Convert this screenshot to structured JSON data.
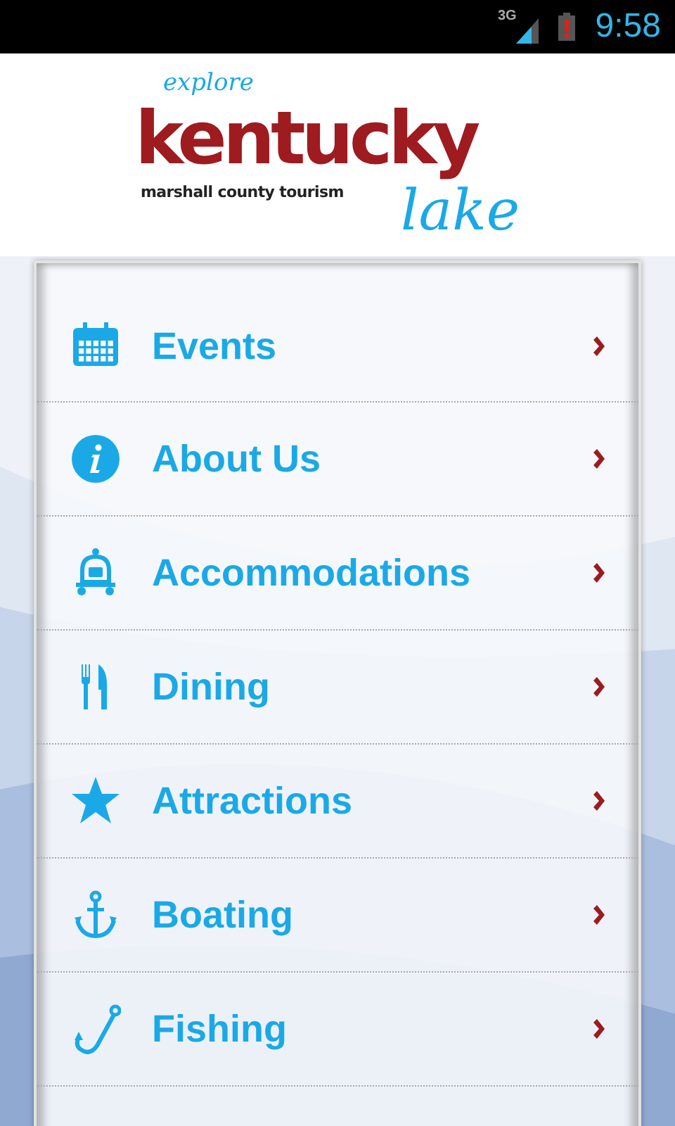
{
  "status_bar": {
    "network": "3G",
    "time": "9:58"
  },
  "logo": {
    "top_word": "explore",
    "main_word": "kentucky",
    "tagline": "marshall county tourism",
    "script_word": "lake"
  },
  "menu": {
    "items": [
      {
        "label": "Events"
      },
      {
        "label": "About Us"
      },
      {
        "label": "Accommodations"
      },
      {
        "label": "Dining"
      },
      {
        "label": "Attractions"
      },
      {
        "label": "Boating"
      },
      {
        "label": "Fishing"
      }
    ]
  }
}
